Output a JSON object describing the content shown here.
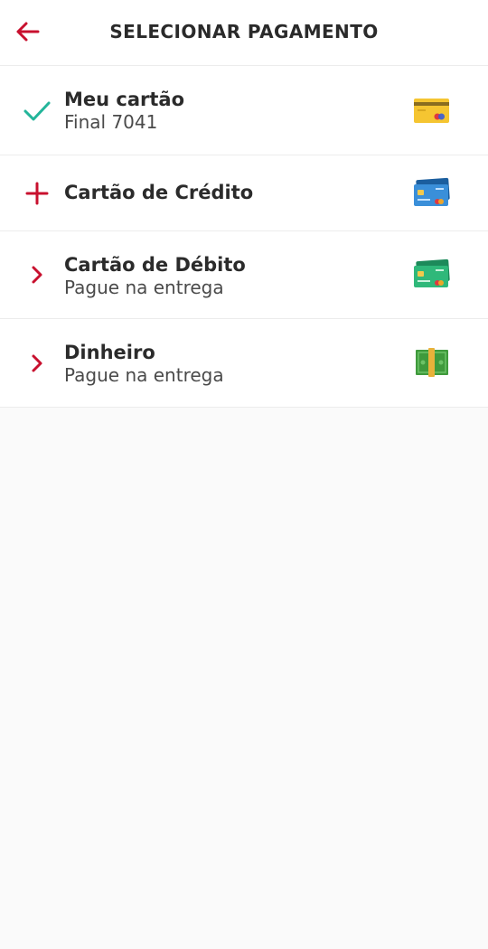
{
  "header": {
    "title": "SELECIONAR PAGAMENTO",
    "back_icon": "arrow-left-icon"
  },
  "colors": {
    "accent": "#c8102e",
    "check": "#23b59a",
    "divider": "#ececec",
    "background": "#fafafa"
  },
  "options": [
    {
      "title": "Meu cartão",
      "subtitle": "Final 7041",
      "marker_icon": "check-icon",
      "card_icon": "yellow-card-icon",
      "selected": true
    },
    {
      "title": "Cartão de Crédito",
      "marker_icon": "plus-icon",
      "card_icon": "blue-cards-icon"
    },
    {
      "title": "Cartão de Débito",
      "subtitle": "Pague na entrega",
      "marker_icon": "chevron-right-icon",
      "card_icon": "green-cards-icon"
    },
    {
      "title": "Dinheiro",
      "subtitle": "Pague na entrega",
      "marker_icon": "chevron-right-icon",
      "card_icon": "money-icon"
    }
  ]
}
